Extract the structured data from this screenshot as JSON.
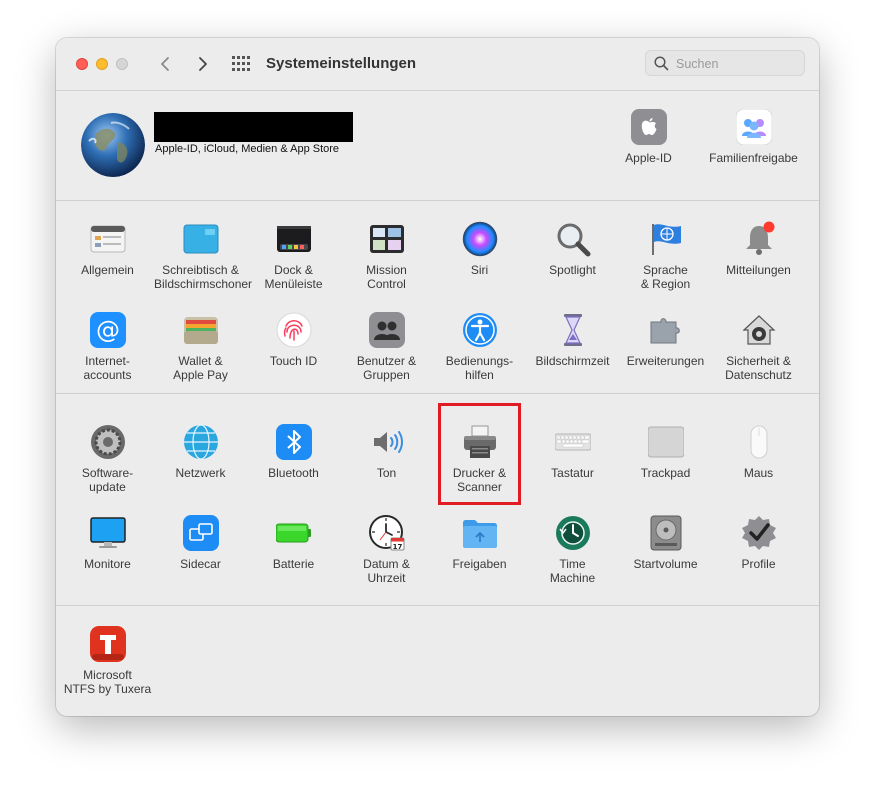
{
  "window": {
    "title": "Systemeinstellungen"
  },
  "search": {
    "placeholder": "Suchen"
  },
  "user": {
    "subtitle": "Apple-ID, iCloud, Medien & App Store"
  },
  "top_items": [
    {
      "label": "Apple-ID",
      "icon": "apple-icon"
    },
    {
      "label": "Familienfreigabe",
      "icon": "family-icon"
    }
  ],
  "row1": [
    {
      "label": "Allgemein",
      "icon": "general-icon"
    },
    {
      "label": "Schreibtisch &\nBildschirmschoner",
      "icon": "desktop-icon"
    },
    {
      "label": "Dock &\nMenüleiste",
      "icon": "dock-icon"
    },
    {
      "label": "Mission\nControl",
      "icon": "mission-control-icon"
    },
    {
      "label": "Siri",
      "icon": "siri-icon"
    },
    {
      "label": "Spotlight",
      "icon": "spotlight-icon"
    },
    {
      "label": "Sprache\n& Region",
      "icon": "language-flag-icon"
    },
    {
      "label": "Mitteilungen",
      "icon": "bell-icon"
    }
  ],
  "row2": [
    {
      "label": "Internet-\naccounts",
      "icon": "at-icon"
    },
    {
      "label": "Wallet &\nApple Pay",
      "icon": "wallet-icon"
    },
    {
      "label": "Touch ID",
      "icon": "fingerprint-icon"
    },
    {
      "label": "Benutzer &\nGruppen",
      "icon": "users-icon"
    },
    {
      "label": "Bedienungs-\nhilfen",
      "icon": "accessibility-icon"
    },
    {
      "label": "Bildschirmzeit",
      "icon": "hourglass-icon"
    },
    {
      "label": "Erweiterungen",
      "icon": "puzzle-icon"
    },
    {
      "label": "Sicherheit &\nDatenschutz",
      "icon": "house-lock-icon"
    }
  ],
  "row3": [
    {
      "label": "Software-\nupdate",
      "icon": "gear-icon"
    },
    {
      "label": "Netzwerk",
      "icon": "globe-icon"
    },
    {
      "label": "Bluetooth",
      "icon": "bluetooth-icon"
    },
    {
      "label": "Ton",
      "icon": "speaker-icon"
    },
    {
      "label": "Drucker &\nScanner",
      "icon": "printer-icon"
    },
    {
      "label": "Tastatur",
      "icon": "keyboard-icon"
    },
    {
      "label": "Trackpad",
      "icon": "trackpad-icon"
    },
    {
      "label": "Maus",
      "icon": "mouse-icon"
    }
  ],
  "row4": [
    {
      "label": "Monitore",
      "icon": "monitor-icon"
    },
    {
      "label": "Sidecar",
      "icon": "sidecar-icon"
    },
    {
      "label": "Batterie",
      "icon": "battery-icon"
    },
    {
      "label": "Datum &\nUhrzeit",
      "icon": "clock-icon"
    },
    {
      "label": "Freigaben",
      "icon": "folder-icon"
    },
    {
      "label": "Time\nMachine",
      "icon": "time-machine-icon"
    },
    {
      "label": "Startvolume",
      "icon": "disk-icon"
    },
    {
      "label": "Profile",
      "icon": "badge-check-icon"
    }
  ],
  "row5": [
    {
      "label": "Microsoft\nNTFS by Tuxera",
      "icon": "tuxera-icon"
    }
  ],
  "colors": {
    "highlight": "#e01b24",
    "close": "#fe5f57",
    "minimize": "#febc2e"
  }
}
